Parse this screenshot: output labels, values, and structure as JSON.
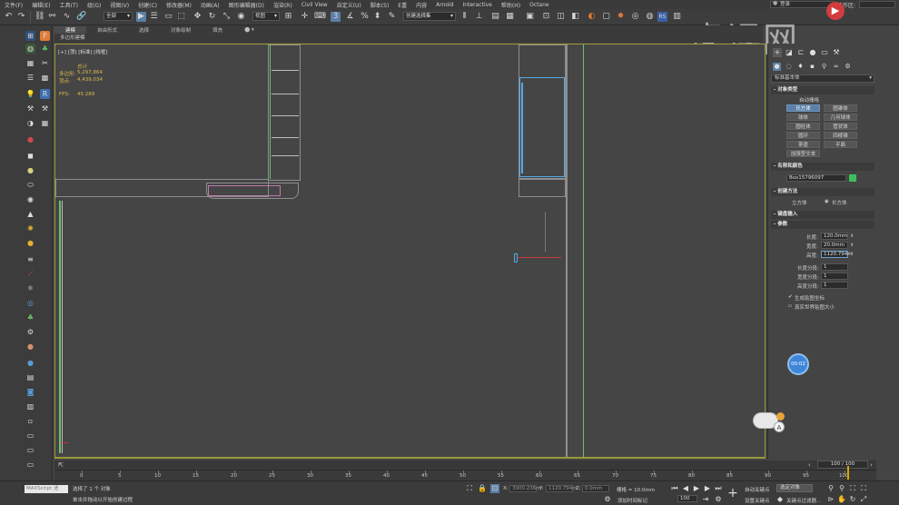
{
  "menubar": {
    "items": [
      "文件(F)",
      "编辑(E)",
      "工具(T)",
      "组(G)",
      "视图(V)",
      "创建(C)",
      "修改器(M)",
      "动画(A)",
      "图形编辑器(D)",
      "渲染(R)",
      "Civil View",
      "自定义(U)",
      "脚本(S)",
      "E重",
      "内容",
      "Arnold",
      "Interactive",
      "帮助(H)",
      "Octane"
    ],
    "login": "登录",
    "workspace_label": "工作区:"
  },
  "toolbar": {
    "filter_select": "全部",
    "view_select": "视图",
    "selection_set": "创建选择集"
  },
  "ribbon": {
    "tabs": [
      "建模",
      "自由形式",
      "选择",
      "对象绘制",
      "填充"
    ],
    "polymodel_label": "多边形建模"
  },
  "viewport": {
    "label": "[+] [顶] [标准] [线框]",
    "stat_header": "总计",
    "polygons_label": "多边形:",
    "polygons_value": "5,297,864",
    "vertices_label": "顶点:",
    "vertices_value": "4,439,034",
    "fps_label": "FPS:",
    "fps_value": "45.289"
  },
  "command_panel": {
    "category": "标准基本体",
    "section_object_type": "对象类型",
    "autogrid": "自动栅格",
    "buttons": [
      [
        "长方体",
        "圆锥体"
      ],
      [
        "球体",
        "几何球体"
      ],
      [
        "圆柱体",
        "管状体"
      ],
      [
        "圆环",
        "四棱锥"
      ],
      [
        "茶壶",
        "平面"
      ]
    ],
    "extra_button": "加强型文本",
    "section_name_color": "名称和颜色",
    "object_name": "Box15796097",
    "section_creation": "创建方法",
    "creation_cube": "立方体",
    "creation_box": "长方体",
    "section_keyboard": "键盘输入",
    "section_params": "参数",
    "length_label": "长度:",
    "length_value": "120.0mm",
    "width_label": "宽度:",
    "width_value": "20.0mm",
    "height_label": "高度:",
    "height_value": "1120.794m",
    "length_segs_label": "长度分段:",
    "length_segs": "1",
    "width_segs_label": "宽度分段:",
    "width_segs": "1",
    "height_segs_label": "高度分段:",
    "height_segs": "1",
    "gen_uv": "生成贴图坐标",
    "real_world": "真实世界贴图大小"
  },
  "timeline": {
    "frame_display": "100 / 100",
    "ticks": [
      "0",
      "5",
      "10",
      "15",
      "20",
      "25",
      "30",
      "35",
      "40",
      "45",
      "50",
      "55",
      "60",
      "65",
      "70",
      "75",
      "80",
      "85",
      "90",
      "95",
      "100"
    ]
  },
  "statusbar": {
    "maxscript": "MAXScript 迷",
    "selected": "选择了 1 个 对象",
    "prompt": "单击并拖动以开始创建过程",
    "x_label": "X:",
    "x_value": "3900.236m",
    "y_label": "Y:",
    "y_value": "1120.794m",
    "z_label": "Z:",
    "z_value": "0.0mm",
    "grid": "栅格 = 10.0mm",
    "add_time_tag": "添加时间标记",
    "auto_key": "自动关键点",
    "set_key": "设置关键点",
    "selected_obj": "选定对象",
    "key_filters": "关键点过滤器...",
    "frame_field": "100"
  },
  "watermark": {
    "text": "虎课网"
  },
  "float_button": "00:02"
}
